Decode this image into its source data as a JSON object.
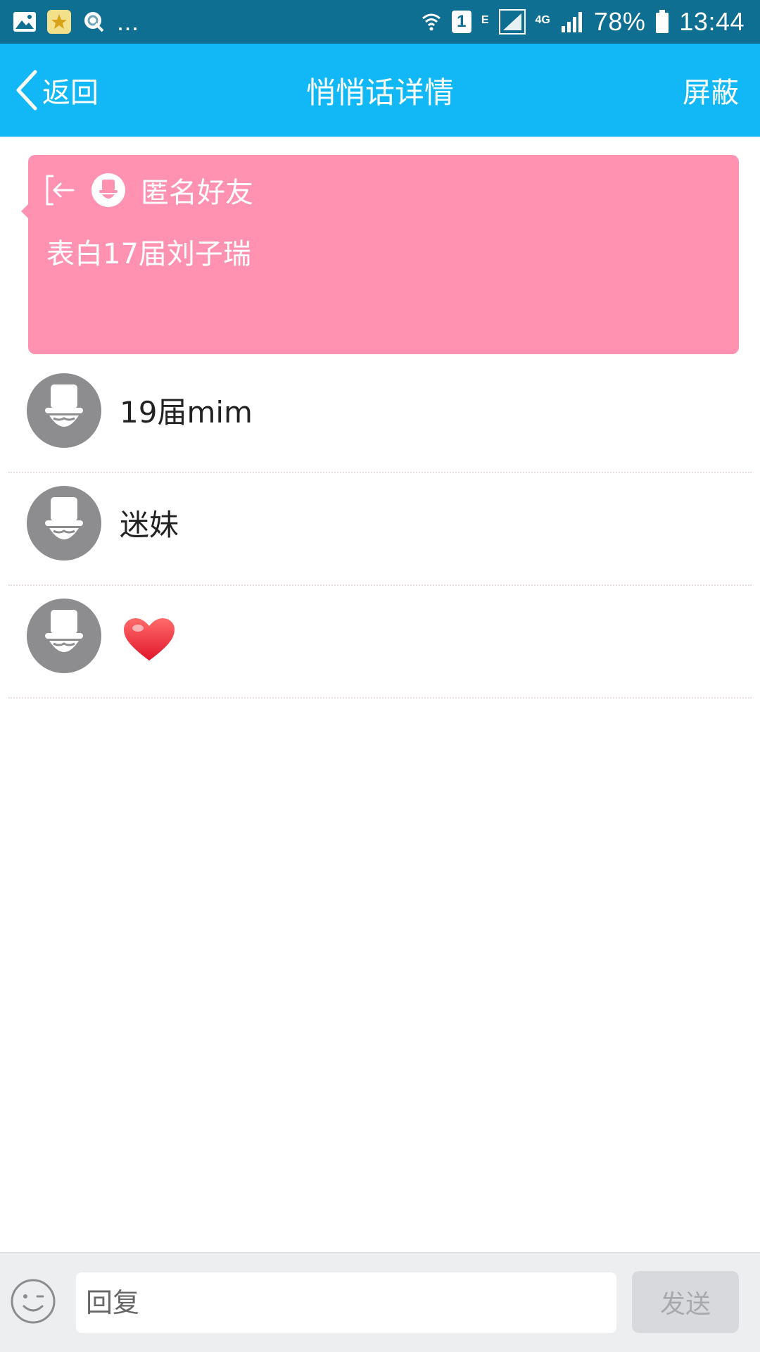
{
  "status_bar": {
    "left_icons": [
      "image-notification-icon",
      "star-app-notification-icon",
      "search-app-notification-icon"
    ],
    "more": "...",
    "sim_badge": "1",
    "network_e": "E",
    "network_4g": "4G",
    "battery_percent": "78%",
    "time": "13:44"
  },
  "header": {
    "back_label": "返回",
    "title": "悄悄话详情",
    "block_label": "屏蔽",
    "background": "#12b7f5"
  },
  "card": {
    "sender": "匿名好友",
    "message": "表白17届刘子瑞",
    "background": "#ff91b1"
  },
  "comments": [
    {
      "text": "19届mim"
    },
    {
      "text": "迷妹"
    },
    {
      "text": "",
      "emoji": "heart-emoji"
    }
  ],
  "bottom_bar": {
    "reply_placeholder": "回复",
    "send_label": "发送"
  }
}
